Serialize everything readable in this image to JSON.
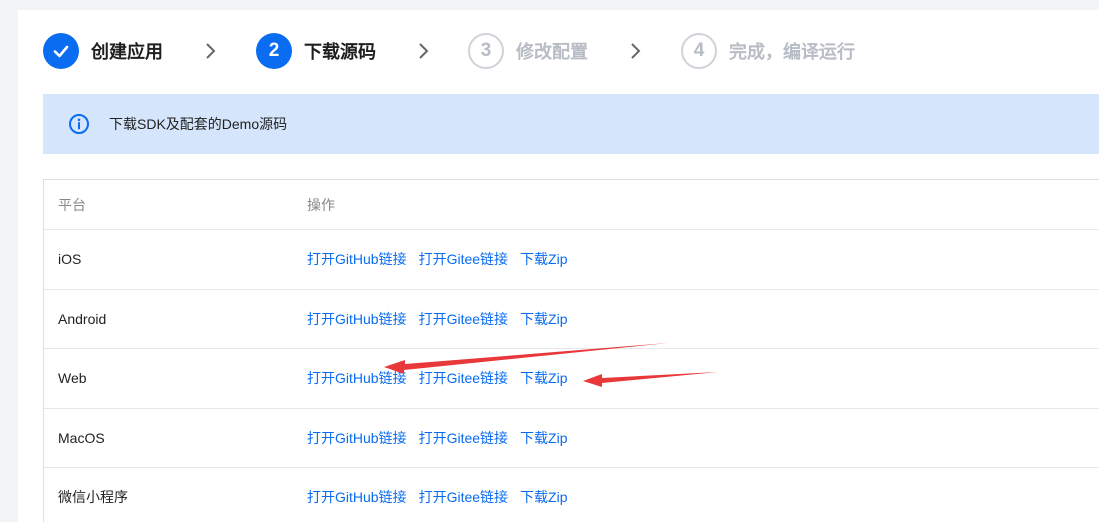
{
  "steps": [
    {
      "number": "",
      "label": "创建应用",
      "status": "done"
    },
    {
      "number": "2",
      "label": "下载源码",
      "status": "active"
    },
    {
      "number": "3",
      "label": "修改配置",
      "status": "pending"
    },
    {
      "number": "4",
      "label": "完成，编译运行",
      "status": "pending"
    }
  ],
  "banner": {
    "text": "下载SDK及配套的Demo源码"
  },
  "table": {
    "headers": {
      "platform": "平台",
      "action": "操作"
    },
    "rows": [
      {
        "platform": "iOS",
        "links": [
          "打开GitHub链接",
          "打开Gitee链接",
          "下载Zip"
        ]
      },
      {
        "platform": "Android",
        "links": [
          "打开GitHub链接",
          "打开Gitee链接",
          "下载Zip"
        ]
      },
      {
        "platform": "Web",
        "links": [
          "打开GitHub链接",
          "打开Gitee链接",
          "下载Zip"
        ]
      },
      {
        "platform": "MacOS",
        "links": [
          "打开GitHub链接",
          "打开Gitee链接",
          "下载Zip"
        ]
      },
      {
        "platform": "微信小程序",
        "links": [
          "打开GitHub链接",
          "打开Gitee链接",
          "下载Zip"
        ]
      }
    ]
  },
  "colors": {
    "accent": "#0a6cf1",
    "annotation": "#e8383a",
    "banner_bg": "#d5e5fb"
  }
}
